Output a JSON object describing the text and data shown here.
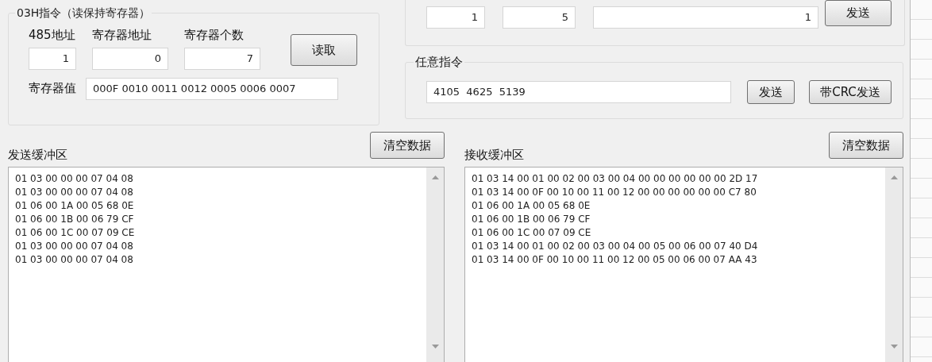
{
  "read_group": {
    "title": "03H指令（读保持寄存器）",
    "fields": [
      {
        "label": "485地址",
        "value": "1"
      },
      {
        "label": "寄存器地址",
        "value": "0"
      },
      {
        "label": "寄存器个数",
        "value": "7"
      }
    ],
    "button": "读取",
    "value_label": "寄存器值",
    "value": "000F 0010 0011 0012 0005 0006 0007"
  },
  "write_group": {
    "fields": [
      {
        "value": "1"
      },
      {
        "value": "5"
      },
      {
        "value": "1"
      }
    ],
    "button": "发送"
  },
  "any_group": {
    "title": "任意指令",
    "value": "4105  4625  5139",
    "buttons": [
      "发送",
      "带CRC发送"
    ]
  },
  "buffers": [
    {
      "title": "发送缓冲区",
      "button": "清空数据",
      "lines": [
        "01 03 00 00 00 07 04 08",
        "01 03 00 00 00 07 04 08",
        "01 06 00 1A 00 05 68 0E",
        "01 06 00 1B 00 06 79 CF",
        "01 06 00 1C 00 07 09 CE",
        "01 03 00 00 00 07 04 08",
        "01 03 00 00 00 07 04 08"
      ]
    },
    {
      "title": "接收缓冲区",
      "button": "清空数据",
      "lines": [
        "01 03 14 00 01 00 02 00 03 00 04 00 00 00 00 00 00 2D 17",
        "01 03 14 00 0F 00 10 00 11 00 12 00 00 00 00 00 00 C7 80",
        "01 06 00 1A 00 05 68 0E",
        "01 06 00 1B 00 06 79 CF",
        "01 06 00 1C 00 07 09 CE",
        "01 03 14 00 01 00 02 00 03 00 04 00 05 00 06 00 07 40 D4",
        "01 03 14 00 0F 00 10 00 11 00 12 00 05 00 06 00 07 AA 43"
      ]
    }
  ]
}
